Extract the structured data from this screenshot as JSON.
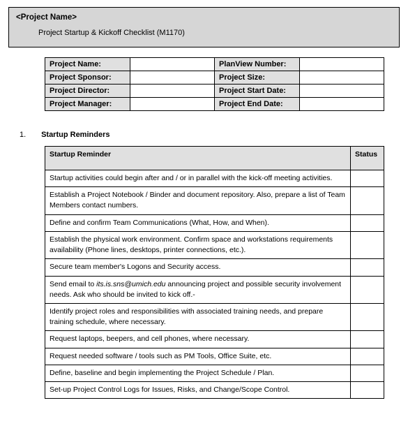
{
  "header": {
    "project_name_placeholder": "<Project Name>",
    "subtitle": "Project Startup & Kickoff Checklist (M1170)"
  },
  "meta": {
    "rows": [
      {
        "l1": "Project Name:",
        "v1": "",
        "l2": "PlanView Number:",
        "v2": ""
      },
      {
        "l1": "Project Sponsor:",
        "v1": "",
        "l2": "Project Size:",
        "v2": ""
      },
      {
        "l1": "Project Director:",
        "v1": "",
        "l2": "Project Start Date:",
        "v2": ""
      },
      {
        "l1": "Project Manager:",
        "v1": "",
        "l2": "Project End Date:",
        "v2": ""
      }
    ]
  },
  "section": {
    "number": "1.",
    "title": "Startup Reminders"
  },
  "checklist": {
    "header_item": "Startup Reminder",
    "header_status": "Status",
    "rows": [
      {
        "text": "Startup activities could begin after and / or in parallel with the kick-off meeting activities."
      },
      {
        "text": "Establish a Project Notebook / Binder and document repository. Also, prepare a list of Team Members contact numbers."
      },
      {
        "text": "Define and confirm Team Communications (What, How, and When)."
      },
      {
        "text": "Establish the physical work environment. Confirm space and workstations requirements availability (Phone lines, desktops, printer connections, etc.)."
      },
      {
        "text": "Secure team member's Logons and Security access."
      },
      {
        "prefix": "Send email to ",
        "email": "its.is.sns@umich.edu",
        "suffix": " announcing project and possible security involvement needs.  Ask who should be invited to kick off.-"
      },
      {
        "text": "Identify project roles and responsibilities with associated training needs, and prepare training schedule, where necessary."
      },
      {
        "text": "Request laptops, beepers, and cell phones, where necessary."
      },
      {
        "text": "Request needed software / tools such as PM Tools, Office Suite, etc."
      },
      {
        "text": "Define, baseline and begin implementing the Project Schedule / Plan."
      },
      {
        "text": "Set-up Project Control Logs for Issues, Risks, and Change/Scope Control."
      }
    ]
  }
}
